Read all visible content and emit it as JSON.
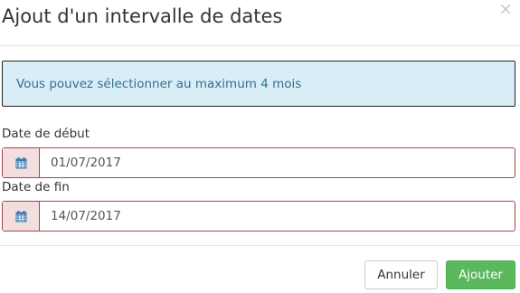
{
  "modal": {
    "title": "Ajout d'un intervalle de dates",
    "close_symbol": "×"
  },
  "alert": {
    "message": "Vous pouvez sélectionner au maximum 4 mois"
  },
  "start_date": {
    "label": "Date de début",
    "value": "01/07/2017",
    "icon": "calendar-icon"
  },
  "end_date": {
    "label": "Date de fin",
    "value": "14/07/2017",
    "icon": "calendar-icon"
  },
  "footer": {
    "cancel_label": "Annuler",
    "add_label": "Ajouter"
  },
  "colors": {
    "error_border": "#a94442",
    "error_addon_bg": "#f2dede",
    "calendar_icon": "#337ab7",
    "alert_bg": "#d9edf7",
    "alert_text": "#31708f",
    "success": "#5cb85c"
  }
}
